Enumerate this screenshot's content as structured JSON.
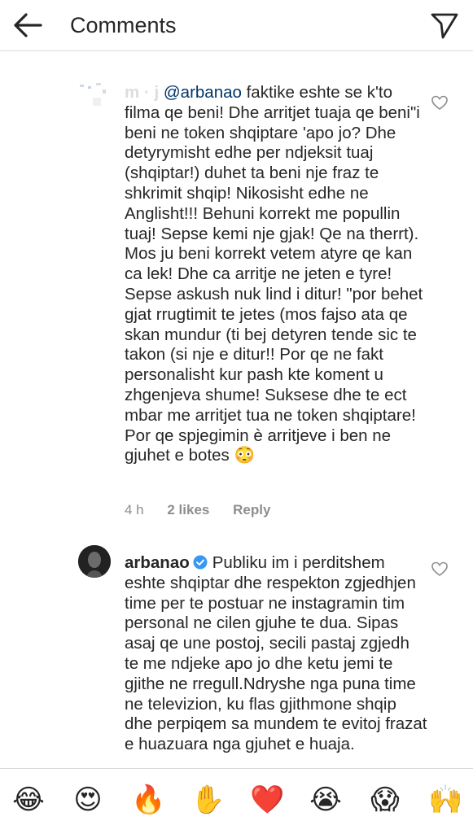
{
  "header": {
    "title": "Comments",
    "back_icon": "arrow-left-icon",
    "send_icon": "paper-plane-icon"
  },
  "comments": [
    {
      "username": "m · j",
      "mention": "@arbanao",
      "text": "faktike eshte se k'to filma qe beni! Dhe arritjet tuaja qe beni\"i beni ne token shqiptare 'apo jo? Dhe detyrymisht edhe per ndjeksit tuaj (shqiptar!) duhet ta beni nje fraz te shkrimit shqip! Nikosisht edhe ne Anglisht!!! Behuni korrekt me popullin tuaj! Sepse kemi nje gjak!  Qe na therrt). Mos ju beni korrekt vetem atyre qe kan ca lek! Dhe ca arritje ne jeten e tyre! Sepse askush nuk lind i ditur! \"por behet gjat rrugtimit te jetes (mos fajso ata qe skan mundur (ti bej detyren tende sic te takon (si nje e ditur!! Por qe ne fakt personalisht kur pash kte koment u zhgenjeva shume! Suksese dhe te ect mbar me arritjet tua ne token shqiptare! Por qe spjegimin è arritjeve i ben ne gjuhet e botes 😳",
      "time": "4 h",
      "likes": "2 likes",
      "reply": "Reply"
    },
    {
      "username": "arbanao",
      "verified": true,
      "text": "Publiku im i perditshem eshte shqiptar dhe respekton zgjedhjen time per te postuar ne instagramin tim personal ne cilen gjuhe te dua. Sipas asaj qe une postoj, secili pastaj zgjedh te me ndjeke apo jo dhe ketu jemi te gjithe ne rregull.Ndryshe nga puna time ne televizion, ku flas gjithmone shqip dhe perpiqem sa mundem te evitoj frazat e huazuara nga gjuhet e huaja."
    }
  ],
  "reactions": [
    "😂",
    "😍",
    "🔥",
    "✋",
    "❤️",
    "😭",
    "😱",
    "🙌"
  ],
  "colors": {
    "accent": "#3897f0",
    "heart_red": "#ed4956",
    "muted": "#8e8e8e"
  }
}
